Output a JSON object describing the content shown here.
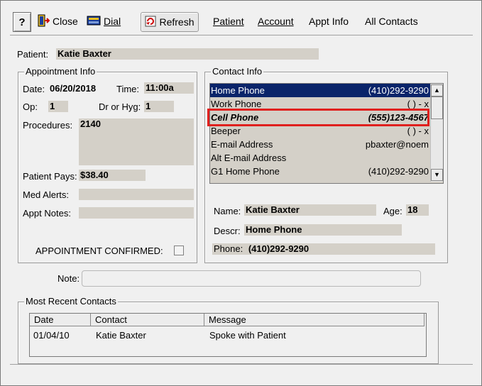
{
  "toolbar": {
    "help_label": "?",
    "close_label": "Close",
    "dial_label": "Dial",
    "refresh_label": "Refresh",
    "menu": [
      "Patient",
      "Account",
      "Appt Info",
      "All Contacts"
    ]
  },
  "patient": {
    "label": "Patient:",
    "value": "Katie Baxter"
  },
  "appointment_info": {
    "legend": "Appointment Info",
    "date_label": "Date:",
    "date_value": "06/20/2018",
    "time_label": "Time:",
    "time_value": "11:00a",
    "op_label": "Op:",
    "op_value": "1",
    "dr_label": "Dr or Hyg:",
    "dr_value": "1",
    "procedures_label": "Procedures:",
    "procedures_value": "2140",
    "pays_label": "Patient Pays:",
    "pays_value": "$38.40",
    "alerts_label": "Med Alerts:",
    "alerts_value": "",
    "notes_label": "Appt Notes:",
    "notes_value": "",
    "confirmed_label": "APPOINTMENT CONFIRMED:",
    "confirmed_checked": false
  },
  "contact_info": {
    "legend": "Contact Info",
    "rows": [
      {
        "name": "Home Phone",
        "value": "(410)292-9290"
      },
      {
        "name": "Work Phone",
        "value": "(   )   -      x"
      },
      {
        "name": "Cell Phone",
        "value": "(555)123-4567"
      },
      {
        "name": "Beeper",
        "value": "(   )   -      x"
      },
      {
        "name": "E-mail Address",
        "value": "pbaxter@noem"
      },
      {
        "name": "Alt E-mail Address",
        "value": ""
      },
      {
        "name": "G1 Home Phone",
        "value": "(410)292-9290"
      }
    ],
    "name_label": "Name:",
    "name_value": "Katie Baxter",
    "age_label": "Age:",
    "age_value": "18",
    "descr_label": "Descr:",
    "descr_value": "Home Phone",
    "phone_label": "Phone:",
    "phone_value": "(410)292-9290"
  },
  "note": {
    "label": "Note:",
    "value": ""
  },
  "recent_contacts": {
    "legend": "Most Recent Contacts",
    "headers": [
      "Date",
      "Contact",
      "Message"
    ],
    "rows": [
      {
        "date": "01/04/10",
        "contact": "Katie Baxter",
        "message": "Spoke with Patient"
      }
    ]
  },
  "colors": {
    "selection": "#0a246a",
    "field_bg": "#d4d0c8",
    "highlight": "#e0201e"
  }
}
